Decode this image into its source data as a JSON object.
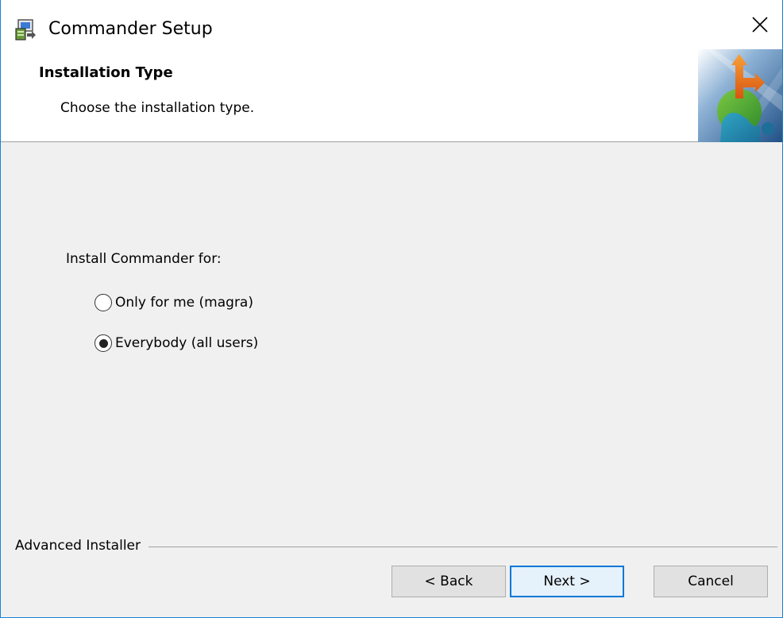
{
  "window": {
    "title": "Commander Setup",
    "app_icon": "installer-icon",
    "close_icon": "close-icon"
  },
  "header": {
    "title": "Installation Type",
    "subtitle": "Choose the installation type.",
    "logo": "installer-puzzle-logo"
  },
  "body": {
    "prompt": "Install Commander for:",
    "options": [
      {
        "label": "Only for me (magra)",
        "selected": false
      },
      {
        "label": "Everybody (all users)",
        "selected": true
      }
    ]
  },
  "footer": {
    "group_label": "Advanced Installer",
    "back_label": "< Back",
    "next_label": "Next >",
    "cancel_label": "Cancel"
  },
  "colors": {
    "accent": "#0078d7",
    "border": "#1883d7",
    "background": "#f0f0f0"
  }
}
